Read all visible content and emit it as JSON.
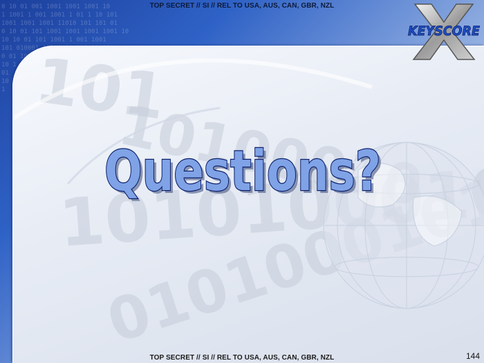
{
  "slide": {
    "classification_top": "TOP SECRET // SI // REL TO USA, AUS, CAN, GBR, NZL",
    "classification_bottom": "TOP SECRET // SI // REL TO USA, AUS, CAN, GBR, NZL",
    "title": "Questions?",
    "page_number": "144",
    "logo_text": "KEYSCORE",
    "logo_letter": "X"
  },
  "colors": {
    "title_fill": "#7fa3e6",
    "title_stroke": "#0c1f6b",
    "header_blue": "#1c3f9c",
    "panel": "#e6ebf4"
  },
  "icons": {
    "logo": "keyscore-logo",
    "globe": "globe-watermark"
  }
}
